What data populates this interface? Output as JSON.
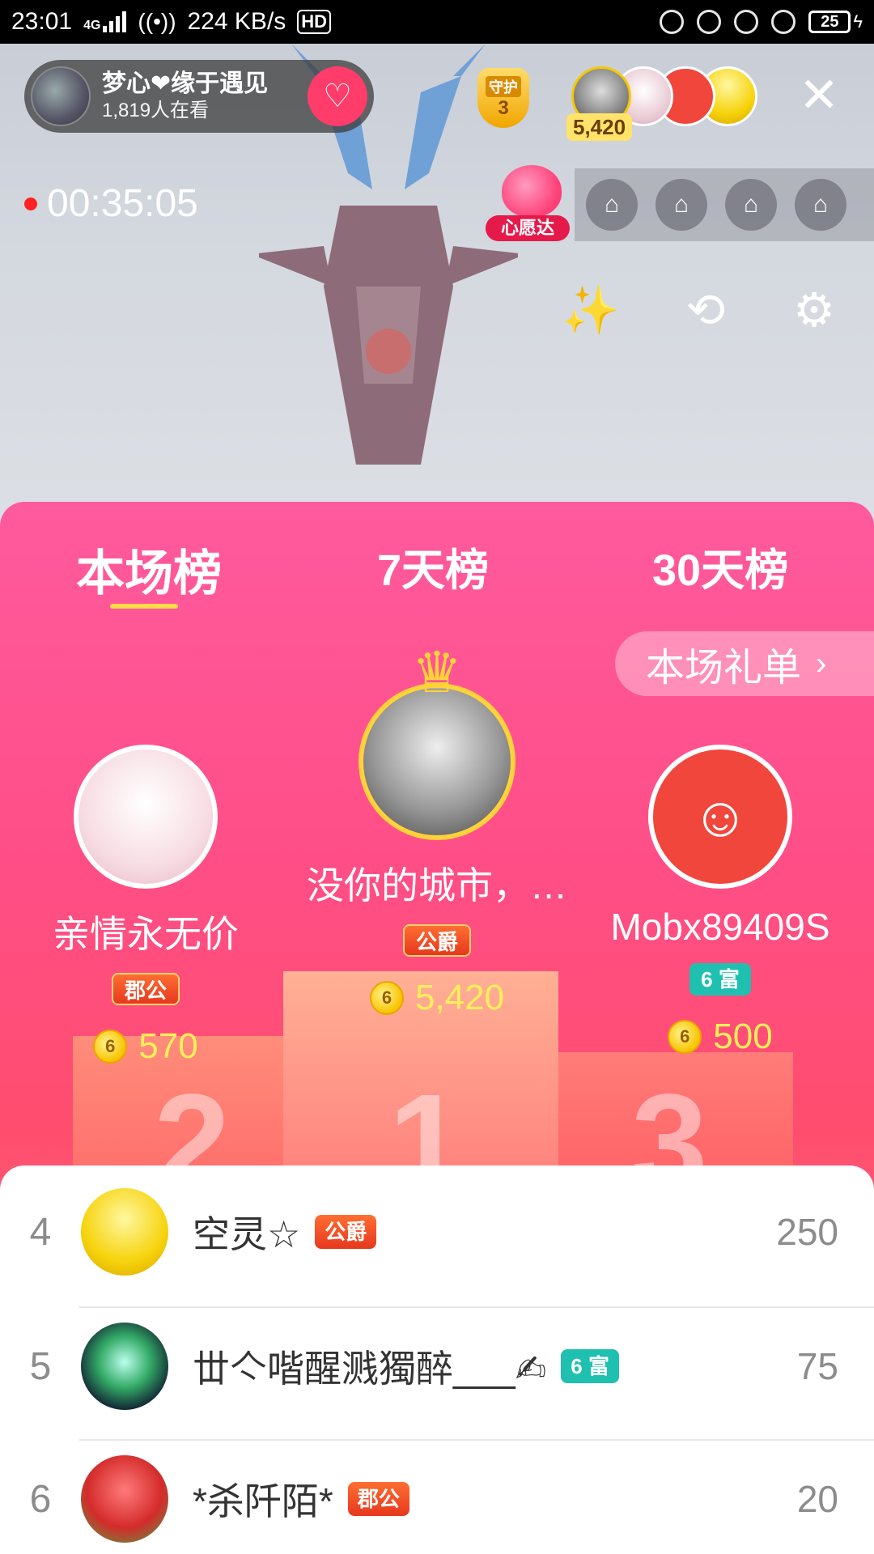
{
  "status_bar": {
    "time": "23:01",
    "network": "4G",
    "speed": "224 KB/s",
    "hd": "HD",
    "battery": "25"
  },
  "live": {
    "host_name": "梦心❤缘于遇见",
    "viewers": "1,819人在看",
    "guard_label": "守护",
    "guard_count": "3",
    "top_score": "5,420",
    "timer": "00:35:05",
    "wish_tag": "心愿达"
  },
  "tabs": [
    "本场榜",
    "7天榜",
    "30天榜"
  ],
  "gift_list_button": "本场礼单",
  "top3": [
    {
      "rank": "1",
      "name": "没你的城市，…",
      "badge": "公爵",
      "score": "5,420"
    },
    {
      "rank": "2",
      "name": "亲情永无价",
      "badge": "郡公",
      "score": "570"
    },
    {
      "rank": "3",
      "name": "Mobx89409S",
      "badge": "6 富",
      "score": "500"
    }
  ],
  "coin_symbol": "6",
  "list": [
    {
      "rank": "4",
      "name": "空灵☆",
      "badge": "公爵",
      "value": "250"
    },
    {
      "rank": "5",
      "name": "丗亽喈醒溅獨醉___✍",
      "badge": "6 富",
      "value": "75"
    },
    {
      "rank": "6",
      "name": "*杀阡陌*",
      "badge": "郡公",
      "value": "20"
    }
  ],
  "colors": {
    "panel_top": "#ff5a9e",
    "panel_bottom": "#ff4d6e",
    "score_yellow": "#ffef5a",
    "badge_teal": "#1fc0b0",
    "follow_red": "#ff3c6a"
  }
}
